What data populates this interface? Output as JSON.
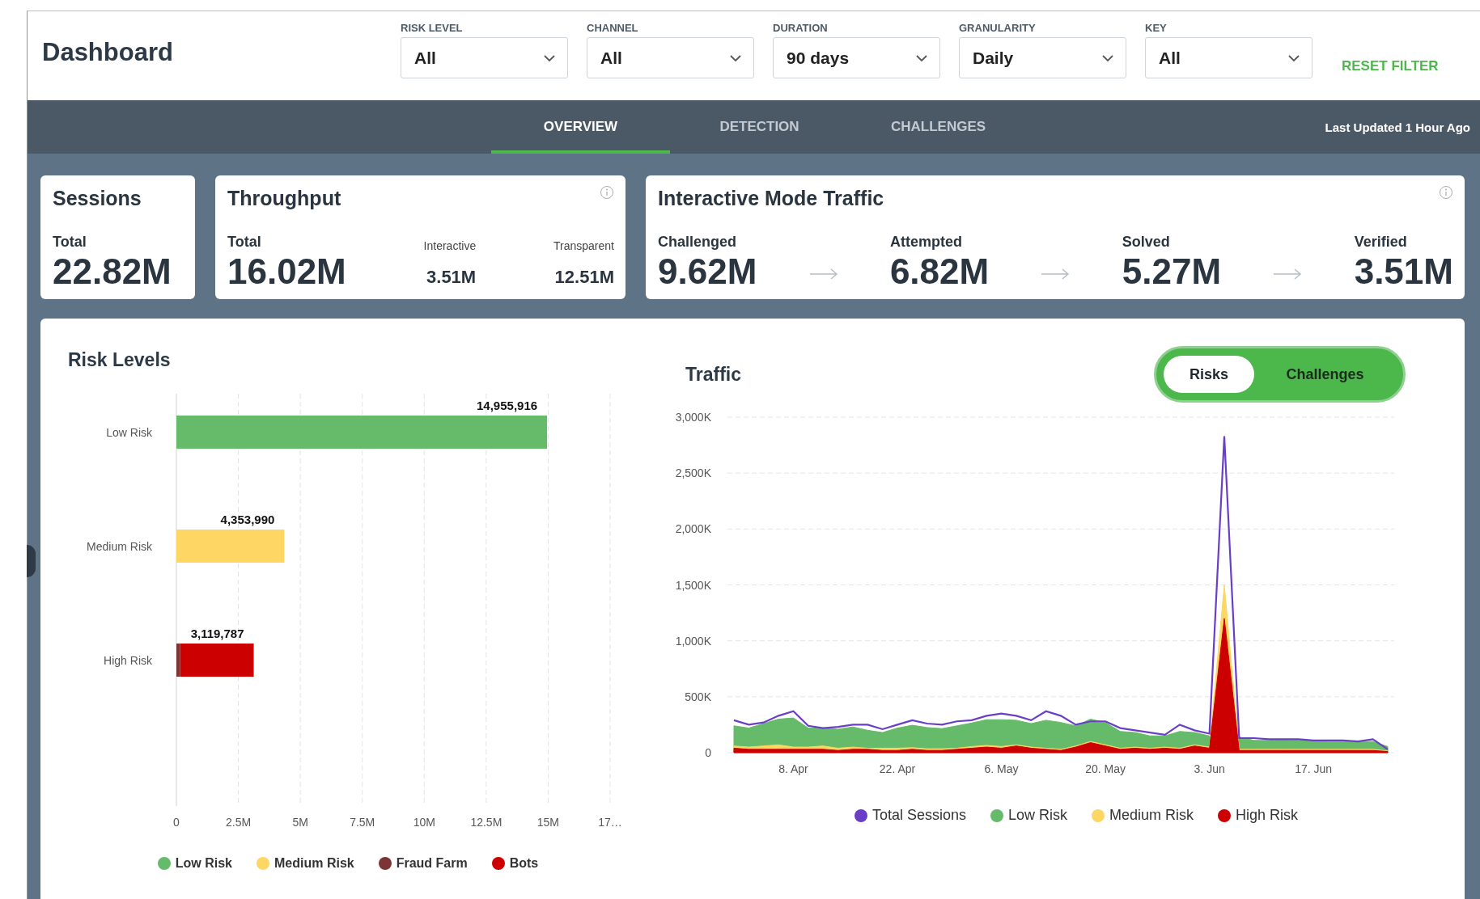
{
  "header": {
    "title": "Dashboard",
    "filters": [
      {
        "label": "RISK LEVEL",
        "value": "All"
      },
      {
        "label": "CHANNEL",
        "value": "All"
      },
      {
        "label": "DURATION",
        "value": "90 days"
      },
      {
        "label": "GRANULARITY",
        "value": "Daily"
      },
      {
        "label": "KEY",
        "value": "All"
      }
    ],
    "reset_button": "RESET FILTER"
  },
  "nav": {
    "tabs": [
      {
        "label": "OVERVIEW",
        "selected": true
      },
      {
        "label": "DETECTION",
        "selected": false
      },
      {
        "label": "CHALLENGES",
        "selected": false
      }
    ],
    "last_updated": "Last Updated 1 Hour Ago"
  },
  "cards": [
    {
      "title": "Sessions",
      "kind": "metrics",
      "info": false,
      "metrics": [
        {
          "label": "Total",
          "value": "22.82M",
          "kind": "large"
        }
      ]
    },
    {
      "title": "Throughput",
      "kind": "metrics",
      "info": true,
      "metrics": [
        {
          "label": "Total",
          "value": "16.02M",
          "kind": "large"
        },
        {
          "label": "Interactive",
          "value": "3.51M",
          "kind": "small"
        },
        {
          "label": "Transparent",
          "value": "12.51M",
          "kind": "small"
        }
      ]
    },
    {
      "title": "Interactive Mode Traffic",
      "kind": "funnel",
      "info": true,
      "metrics": [
        {
          "label": "Challenged",
          "value": "9.62M",
          "kind": "large"
        },
        {
          "label": "Attempted",
          "value": "6.82M",
          "kind": "large"
        },
        {
          "label": "Solved",
          "value": "5.27M",
          "kind": "large"
        },
        {
          "label": "Verified",
          "value": "3.51M",
          "kind": "large"
        }
      ]
    }
  ],
  "risk_levels": {
    "title": "Risk Levels",
    "chart_data": {
      "type": "bar",
      "orientation": "horizontal",
      "stacked": true,
      "grid": true,
      "categories": [
        "Low Risk",
        "Medium Risk",
        "High Risk"
      ],
      "series": [
        {
          "name": "Low Risk",
          "color": "#66bb6a",
          "values": [
            14955916,
            null,
            null
          ]
        },
        {
          "name": "Medium Risk",
          "color": "#fdd663",
          "values": [
            null,
            4353990,
            null
          ]
        },
        {
          "name": "Fraud Farm",
          "color": "#7b3535",
          "values": [
            null,
            null,
            150000
          ]
        },
        {
          "name": "Bots",
          "color": "#cc0000",
          "values": [
            null,
            null,
            2969787
          ]
        }
      ],
      "value_labels": [
        "14,955,916",
        "4,353,990",
        "3,119,787"
      ],
      "xlim": [
        0,
        17500000
      ],
      "xticks": [
        {
          "value": 0,
          "label": "0"
        },
        {
          "value": 2500000,
          "label": "2.5M"
        },
        {
          "value": 5000000,
          "label": "5M"
        },
        {
          "value": 7500000,
          "label": "7.5M"
        },
        {
          "value": 10000000,
          "label": "10M"
        },
        {
          "value": 12500000,
          "label": "12.5M"
        },
        {
          "value": 15000000,
          "label": "15M"
        },
        {
          "value": 17500000,
          "label": "17…"
        }
      ]
    }
  },
  "traffic": {
    "title": "Traffic",
    "toggle": [
      {
        "label": "Risks",
        "selected": true
      },
      {
        "label": "Challenges",
        "selected": false
      }
    ],
    "chart_data": {
      "type": "area",
      "stacked": false,
      "grid": true,
      "categories": [
        null,
        null,
        null,
        null,
        "8. Apr",
        null,
        null,
        null,
        null,
        null,
        null,
        "22. Apr",
        null,
        null,
        null,
        null,
        null,
        null,
        "6. May",
        null,
        null,
        null,
        null,
        null,
        null,
        "20. May",
        null,
        null,
        null,
        null,
        null,
        null,
        "3. Jun",
        null,
        null,
        null,
        null,
        null,
        null,
        "17. Jun",
        null,
        null,
        null,
        null,
        null
      ],
      "series": [
        {
          "name": "Total Sessions",
          "color": "#6a3fc8",
          "type": "line",
          "values": [
            290,
            250,
            270,
            330,
            370,
            240,
            220,
            230,
            250,
            250,
            210,
            250,
            290,
            260,
            250,
            280,
            290,
            330,
            350,
            330,
            290,
            370,
            330,
            250,
            280,
            280,
            220,
            200,
            180,
            160,
            250,
            200,
            170,
            2830,
            130,
            130,
            120,
            120,
            120,
            110,
            110,
            110,
            100,
            120,
            30
          ]
        },
        {
          "name": "Low Risk",
          "color": "#66bb6a",
          "type": "area",
          "values": [
            240,
            220,
            260,
            300,
            310,
            220,
            220,
            210,
            230,
            200,
            180,
            220,
            245,
            225,
            215,
            240,
            265,
            295,
            295,
            290,
            260,
            290,
            270,
            240,
            300,
            270,
            190,
            180,
            150,
            150,
            190,
            180,
            150,
            null,
            140,
            110,
            110,
            120,
            110,
            110,
            100,
            100,
            100,
            100,
            55
          ]
        },
        {
          "name": "Medium Risk",
          "color": "#fdd663",
          "type": "area",
          "values": [
            60,
            50,
            60,
            70,
            50,
            50,
            60,
            40,
            50,
            40,
            40,
            40,
            45,
            35,
            35,
            40,
            55,
            65,
            55,
            70,
            50,
            40,
            30,
            60,
            100,
            70,
            40,
            50,
            40,
            50,
            40,
            70,
            50,
            1500,
            30,
            30,
            30,
            30,
            30,
            30,
            30,
            30,
            30,
            30,
            15
          ]
        },
        {
          "name": "High Risk",
          "color": "#cc0000",
          "type": "area",
          "values": [
            40,
            30,
            30,
            30,
            30,
            30,
            30,
            20,
            30,
            30,
            20,
            20,
            30,
            20,
            20,
            30,
            40,
            50,
            40,
            60,
            40,
            30,
            20,
            50,
            90,
            60,
            30,
            40,
            30,
            40,
            30,
            60,
            40,
            1200,
            20,
            20,
            20,
            20,
            20,
            20,
            20,
            20,
            20,
            20,
            10
          ]
        }
      ],
      "ylim": [
        0,
        3000
      ],
      "yticks": [
        {
          "value": 0,
          "label": "0"
        },
        {
          "value": 500,
          "label": "500K"
        },
        {
          "value": 1000,
          "label": "1,000K"
        },
        {
          "value": 1500,
          "label": "1,500K"
        },
        {
          "value": 2000,
          "label": "2,000K"
        },
        {
          "value": 2500,
          "label": "2,500K"
        },
        {
          "value": 3000,
          "label": "3,000K"
        }
      ]
    }
  }
}
